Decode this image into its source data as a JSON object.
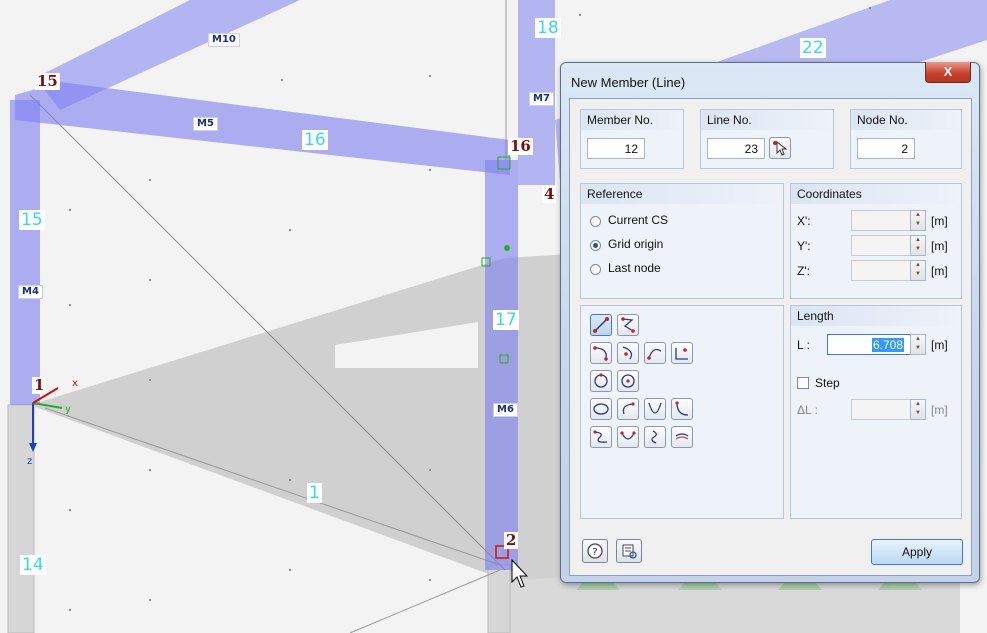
{
  "viewport": {
    "member_labels": [
      "M10",
      "M7",
      "M5",
      "M4",
      "M6"
    ],
    "line_labels": [
      "18",
      "22",
      "16",
      "15",
      "17",
      "1",
      "14"
    ],
    "node_labels": [
      "15",
      "16",
      "4",
      "1",
      "2"
    ],
    "axis_labels": {
      "x": "x",
      "y": "y",
      "z": "z"
    }
  },
  "dialog": {
    "title": "New Member (Line)",
    "close_label": "X",
    "member_no": {
      "label": "Member No.",
      "value": "12"
    },
    "line_no": {
      "label": "Line No.",
      "value": "23"
    },
    "node_no": {
      "label": "Node No.",
      "value": "2"
    },
    "reference": {
      "title": "Reference",
      "options": [
        "Current CS",
        "Grid origin",
        "Last node"
      ],
      "selected": "Grid origin"
    },
    "coordinates": {
      "title": "Coordinates",
      "rows": [
        {
          "label": "X':",
          "value": "",
          "unit": "[m]"
        },
        {
          "label": "Y':",
          "value": "",
          "unit": "[m]"
        },
        {
          "label": "Z':",
          "value": "",
          "unit": "[m]"
        }
      ]
    },
    "length": {
      "title": "Length",
      "label": "L :",
      "value": "6.708",
      "unit": "[m]",
      "step_label": "Step",
      "step_checked": false,
      "delta_label": "ΔL :",
      "delta_unit": "[m]"
    },
    "tools": [
      "line-tool",
      "polyline-tool",
      "arc-tool",
      "arc-center-tool",
      "arc-tangent-tool",
      "arc-point-tool",
      "circle-tool",
      "circle-center-tool",
      "ellipse-tool",
      "elliptic-arc-tool",
      "parabola-tool",
      "spline-tool",
      "bspline-tool",
      "nurbs-tool",
      "helix-tool",
      "offset-tool"
    ],
    "apply_label": "Apply"
  }
}
